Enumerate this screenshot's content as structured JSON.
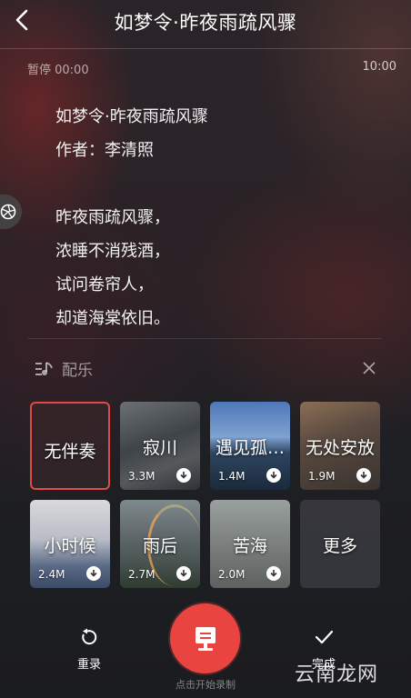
{
  "header": {
    "title": "如梦令·昨夜雨疏风骤"
  },
  "player": {
    "status_time": "暂停 00:00",
    "total_time": "10:00"
  },
  "poem": {
    "title": "如梦令·昨夜雨疏风骤",
    "author": "作者：李清照",
    "lines": [
      "昨夜雨疏风骤，",
      "浓睡不消残酒，",
      "试问卷帘人，",
      "却道海棠依旧。"
    ]
  },
  "music": {
    "label": "配乐",
    "tracks": [
      {
        "name": "无伴奏",
        "size": ""
      },
      {
        "name": "寂川",
        "size": "3.3M"
      },
      {
        "name": "遇见孤…",
        "size": "1.4M"
      },
      {
        "name": "无处安放",
        "size": "1.9M"
      },
      {
        "name": "小时候",
        "size": "2.4M"
      },
      {
        "name": "雨后",
        "size": "2.7M"
      },
      {
        "name": "苦海",
        "size": "2.0M"
      },
      {
        "name": "更多",
        "size": ""
      }
    ]
  },
  "controls": {
    "redo_label": "重录",
    "record_hint": "点击开始录制",
    "done_label": "完成"
  },
  "watermark": "云南龙网",
  "colors": {
    "accent": "#e9443f"
  }
}
